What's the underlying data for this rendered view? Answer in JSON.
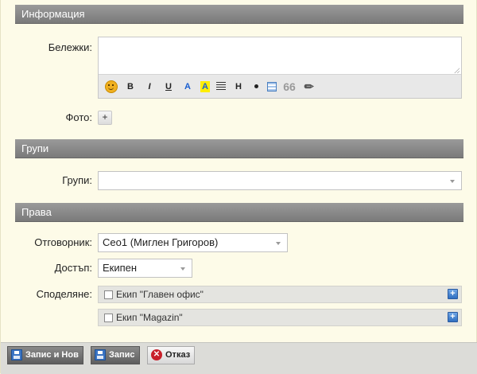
{
  "sections": {
    "info": "Информация",
    "groups": "Групи",
    "rights": "Права"
  },
  "notes": {
    "label": "Бележки:",
    "value": "",
    "toolbar": {
      "bold": "B",
      "italic": "I",
      "underline": "U",
      "text_color": "A",
      "highlight": "A",
      "heading": "H",
      "quote": "66",
      "attach": "✐"
    }
  },
  "photo": {
    "label": "Фото:",
    "add_button": "+"
  },
  "groups_field": {
    "label": "Групи:",
    "value": ""
  },
  "responsible": {
    "label": "Отговорник:",
    "value": "Ceo1 (Миглен Григоров)"
  },
  "access": {
    "label": "Достъп:",
    "value": "Екипен"
  },
  "sharing": {
    "label": "Споделяне:",
    "items": [
      {
        "label": "Екип \"Главен офис\"",
        "checked": false
      },
      {
        "label": "Екип \"Magazin\"",
        "checked": false
      }
    ]
  },
  "footer": {
    "save_new": "Запис и Нов",
    "save": "Запис",
    "cancel": "Отказ"
  },
  "colors": {
    "section_header": "#858585",
    "page_bg": "#fdfbe8",
    "accent_blue": "#3a74c4",
    "cancel_red": "#c8202a"
  }
}
